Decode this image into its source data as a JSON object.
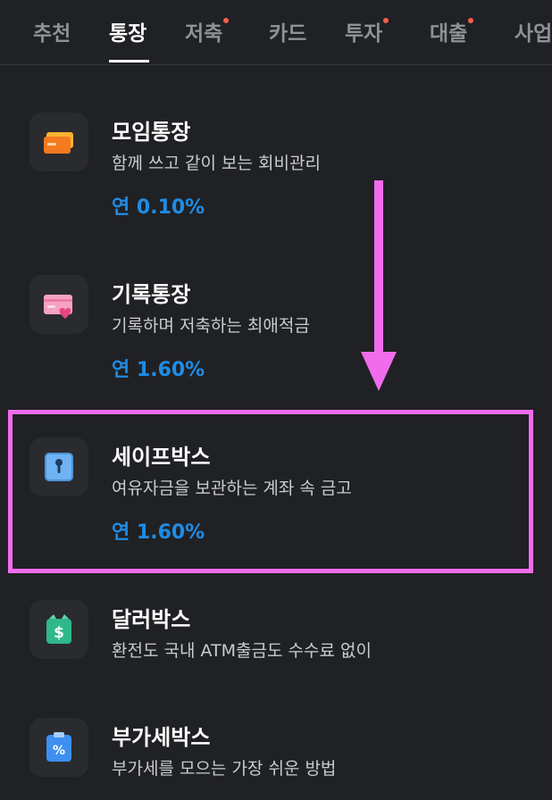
{
  "tabs": [
    {
      "label": "추천",
      "new": false
    },
    {
      "label": "통장",
      "new": false,
      "active": true
    },
    {
      "label": "저축",
      "new": true
    },
    {
      "label": "카드",
      "new": false
    },
    {
      "label": "투자",
      "new": true
    },
    {
      "label": "대출",
      "new": true
    },
    {
      "label": "사업",
      "new": false
    }
  ],
  "items": [
    {
      "icon": "cards-icon",
      "title": "모임통장",
      "desc": "함께 쓰고 같이 보는 회비관리",
      "rate": "연 0.10%"
    },
    {
      "icon": "card-heart-icon",
      "title": "기록통장",
      "desc": "기록하며 저축하는 최애적금",
      "rate": "연 1.60%"
    },
    {
      "icon": "safe-box-icon",
      "title": "세이프박스",
      "desc": "여유자금을 보관하는 계좌 속 금고",
      "rate": "연 1.60%"
    },
    {
      "icon": "dollar-box-icon",
      "title": "달러박스",
      "desc": "환전도 국내 ATM출금도 수수료 없이",
      "rate": ""
    },
    {
      "icon": "vat-box-icon",
      "title": "부가세박스",
      "desc": "부가세를 모으는 가장 쉬운 방법",
      "rate": ""
    }
  ],
  "colors": {
    "accent": "#1f8ce6",
    "new_dot": "#f4604d",
    "annotation": "#f06cec"
  }
}
